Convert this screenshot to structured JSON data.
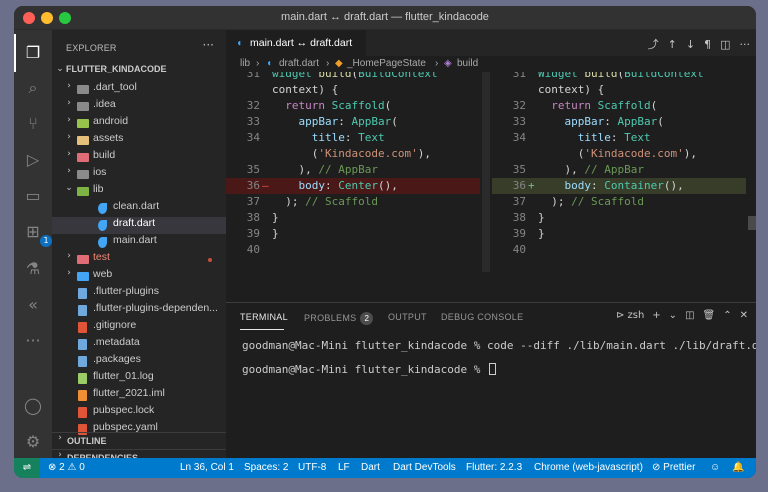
{
  "window": {
    "title": "main.dart ↔ draft.dart — flutter_kindacode"
  },
  "colors": {
    "accent": "#007acc",
    "deleted_bg": "#4b1818",
    "inserted_bg": "#373d29"
  },
  "activity_bar": {
    "items": [
      "explorer-icon",
      "search-icon",
      "source-control-icon",
      "run-debug-icon",
      "remote-explorer-icon",
      "extensions-icon",
      "testing-icon",
      "flutter-icon",
      "more-icon"
    ],
    "extensions_badge": "1",
    "bottom": [
      "account-icon",
      "settings-gear-icon"
    ]
  },
  "explorer": {
    "header": "EXPLORER",
    "more": "···",
    "root": "FLUTTER_KINDACODE",
    "items": [
      {
        "label": ".dart_tool",
        "kind": "folder",
        "color": "#cccccc"
      },
      {
        "label": ".idea",
        "kind": "folder",
        "color": "#cccccc"
      },
      {
        "label": "android",
        "kind": "folder",
        "color": "#cccccc"
      },
      {
        "label": "assets",
        "kind": "folder",
        "color": "#cccccc"
      },
      {
        "label": "build",
        "kind": "folder",
        "color": "#cccccc"
      },
      {
        "label": "ios",
        "kind": "folder",
        "color": "#cccccc"
      },
      {
        "label": "lib",
        "kind": "folder-open",
        "color": "#cccccc"
      },
      {
        "label": "clean.dart",
        "kind": "dart",
        "color": "#cccccc"
      },
      {
        "label": "draft.dart",
        "kind": "dart",
        "color": "#ffffff"
      },
      {
        "label": "main.dart",
        "kind": "dart",
        "color": "#cccccc"
      },
      {
        "label": "test",
        "kind": "folder",
        "color": "#f48771"
      },
      {
        "label": "web",
        "kind": "folder",
        "color": "#cccccc"
      },
      {
        "label": ".flutter-plugins",
        "kind": "file",
        "color": "#cccccc"
      },
      {
        "label": ".flutter-plugins-dependen...",
        "kind": "file",
        "color": "#cccccc"
      },
      {
        "label": ".gitignore",
        "kind": "file",
        "color": "#cccccc"
      },
      {
        "label": ".metadata",
        "kind": "file",
        "color": "#cccccc"
      },
      {
        "label": ".packages",
        "kind": "file",
        "color": "#cccccc"
      },
      {
        "label": "flutter_01.log",
        "kind": "file",
        "color": "#cccccc"
      },
      {
        "label": "flutter_2021.iml",
        "kind": "file",
        "color": "#cccccc"
      },
      {
        "label": "pubspec.lock",
        "kind": "file",
        "color": "#cccccc"
      },
      {
        "label": "pubspec.yaml",
        "kind": "file",
        "color": "#cccccc"
      }
    ],
    "outline": "OUTLINE",
    "dependencies": "DEPENDENCIES"
  },
  "editor": {
    "tab_label": "main.dart ↔ draft.dart",
    "breadcrumbs": [
      "lib",
      "draft.dart",
      "_HomePageState",
      "build"
    ],
    "left_lines": [
      {
        "n": "31",
        "t": "widget build(BuildContext"
      },
      {
        "n": "",
        "t": "context) {"
      },
      {
        "n": "32",
        "t": "  return Scaffold("
      },
      {
        "n": "33",
        "t": "    appBar: AppBar("
      },
      {
        "n": "34",
        "t": "      title: Text"
      },
      {
        "n": "",
        "t": "      ('Kindacode.com'),"
      },
      {
        "n": "35",
        "t": "    ), // AppBar"
      },
      {
        "n": "36",
        "t": "    body: Center(),"
      },
      {
        "n": "37",
        "t": "  ); // Scaffold"
      },
      {
        "n": "38",
        "t": "}"
      },
      {
        "n": "39",
        "t": "}"
      },
      {
        "n": "40",
        "t": ""
      }
    ],
    "right_lines": [
      {
        "n": "31",
        "t": "Widget build(BuildContext"
      },
      {
        "n": "",
        "t": "context) {"
      },
      {
        "n": "32",
        "t": "  return Scaffold("
      },
      {
        "n": "33",
        "t": "    appBar: AppBar("
      },
      {
        "n": "34",
        "t": "      title: Text"
      },
      {
        "n": "",
        "t": "      ('Kindacode.com'),"
      },
      {
        "n": "35",
        "t": "    ), // AppBar"
      },
      {
        "n": "36",
        "t": "    body: Container(),"
      },
      {
        "n": "37",
        "t": "  ); // Scaffold"
      },
      {
        "n": "38",
        "t": "}"
      },
      {
        "n": "39",
        "t": "}"
      },
      {
        "n": "40",
        "t": ""
      }
    ]
  },
  "panel": {
    "tabs": [
      "TERMINAL",
      "PROBLEMS",
      "OUTPUT",
      "DEBUG CONSOLE"
    ],
    "problems_count": "2",
    "shell": "zsh",
    "lines": [
      "goodman@Mac-Mini flutter_kindacode % code --diff ./lib/main.dart ./lib/draft.dart",
      "goodman@Mac-Mini flutter_kindacode % "
    ]
  },
  "status_bar": {
    "problems": "⊗ 2 ⚠ 0",
    "position": "Ln 36, Col 1",
    "spaces": "Spaces: 2",
    "encoding": "UTF-8",
    "eol": "LF",
    "language": "Dart",
    "devtools": "Dart DevTools",
    "flutter": "Flutter: 2.2.3",
    "device": "Chrome (web-javascript)",
    "prettier": "Prettier"
  }
}
